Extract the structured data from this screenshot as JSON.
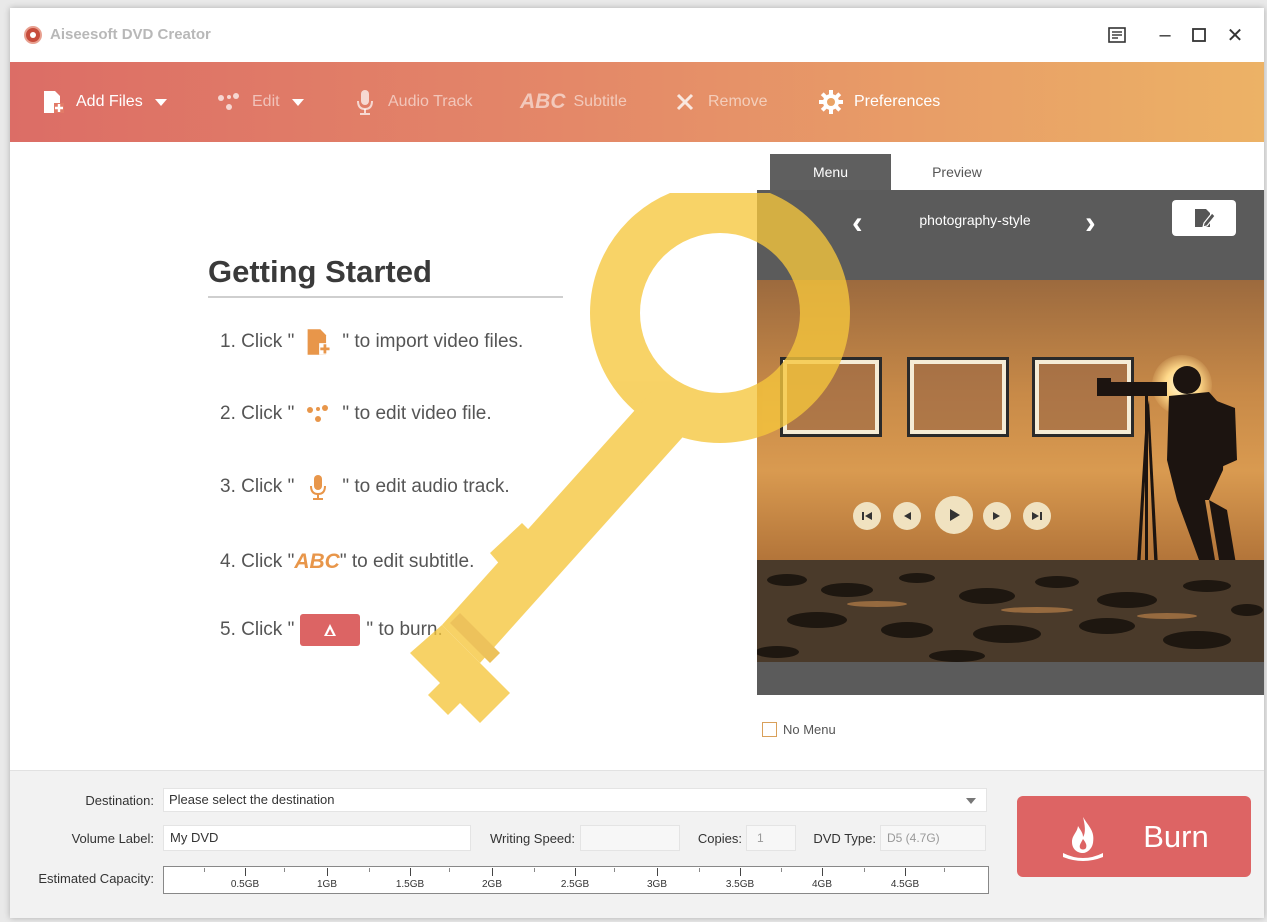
{
  "window": {
    "title": "Aiseesoft DVD Creator",
    "controls": {
      "menu": "☰",
      "minimize": "–",
      "maximize": "☐",
      "close": "✕"
    }
  },
  "toolbar": {
    "add_files": "Add Files",
    "edit": "Edit",
    "audio_track": "Audio Track",
    "subtitle_abc": "ABC",
    "subtitle": "Subtitle",
    "remove": "Remove",
    "preferences": "Preferences"
  },
  "getting_started": {
    "title": "Getting Started",
    "steps": [
      {
        "prefix": "1. Click \"",
        "suffix": "\" to import video files."
      },
      {
        "prefix": "2. Click \"",
        "suffix": "\" to edit video file."
      },
      {
        "prefix": "3. Click \"",
        "suffix": "\" to edit audio track."
      },
      {
        "prefix": "4. Click \"",
        "abc": "ABC",
        "suffix": "\" to edit subtitle."
      },
      {
        "prefix": "5. Click \"",
        "suffix": "\" to burn."
      }
    ]
  },
  "menu_panel": {
    "tabs": [
      "Menu",
      "Preview"
    ],
    "style_name": "photography-style",
    "no_menu_label": "No Menu"
  },
  "bottom": {
    "destination_label": "Destination:",
    "destination_value": "Please select the destination",
    "volume_label": "Volume Label:",
    "volume_value": "My DVD",
    "writing_speed_label": "Writing Speed:",
    "copies_label": "Copies:",
    "copies_value": "1",
    "dvd_type_label": "DVD Type:",
    "dvd_type_value": "D5 (4.7G)",
    "capacity_label": "Estimated Capacity:",
    "capacity_ticks": [
      "0.5GB",
      "1GB",
      "1.5GB",
      "2GB",
      "2.5GB",
      "3GB",
      "3.5GB",
      "4GB",
      "4.5GB"
    ],
    "burn_label": "Burn"
  },
  "colors": {
    "accent": "#dd6464",
    "toolbar_start": "#dc6d66",
    "toolbar_end": "#ecb266",
    "panel_dark": "#5b5b5b"
  }
}
